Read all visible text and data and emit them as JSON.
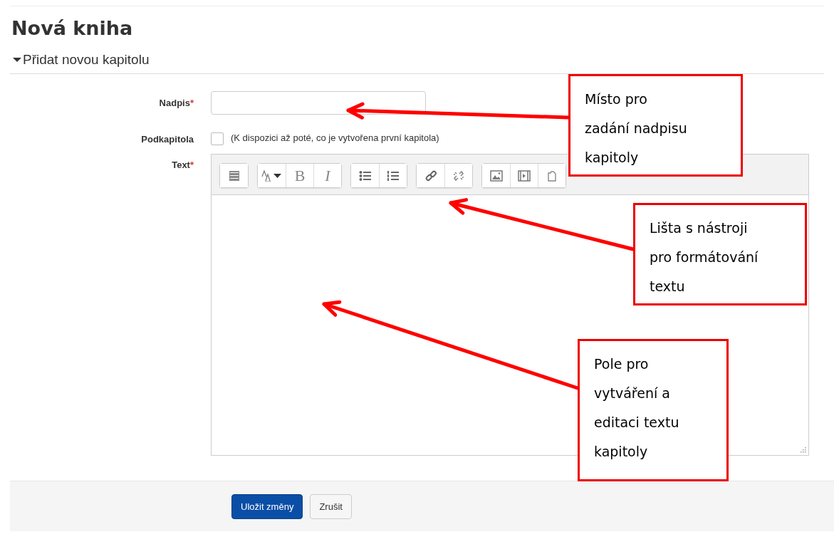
{
  "title": "Nová kniha",
  "section": {
    "label": "Přidat novou kapitolu",
    "expanded": true
  },
  "fields": [
    {
      "kind": "text",
      "label": "Nadpis",
      "required_mark": "*"
    },
    {
      "kind": "checkbox",
      "label": "Podkapitola",
      "checked": false,
      "note": "(K dispozici až poté, co je vytvořena první kapitola)"
    },
    {
      "kind": "editor",
      "label": "Text",
      "required_mark": "*"
    }
  ],
  "toolbar": [
    [
      {
        "kind": "more"
      }
    ],
    [
      {
        "kind": "style"
      },
      {
        "kind": "bold",
        "glyph": "B"
      },
      {
        "kind": "italic",
        "glyph": "I"
      }
    ],
    [
      {
        "kind": "bullets"
      },
      {
        "kind": "numbers"
      }
    ],
    [
      {
        "kind": "link"
      },
      {
        "kind": "unlink"
      }
    ],
    [
      {
        "kind": "image"
      },
      {
        "kind": "media"
      },
      {
        "kind": "files"
      }
    ]
  ],
  "buttons": [
    {
      "label": "Uložit změny",
      "kind": "primary"
    },
    {
      "label": "Zrušit",
      "kind": "default"
    }
  ],
  "annotations": [
    {
      "text": "Místo pro\nzadání nadpisu\nkapitoly"
    },
    {
      "text": "Lišta s nástroji\npro formátování\ntextu"
    },
    {
      "text": "Pole pro\nvytváření a\neditaci textu\nkapitoly"
    }
  ]
}
